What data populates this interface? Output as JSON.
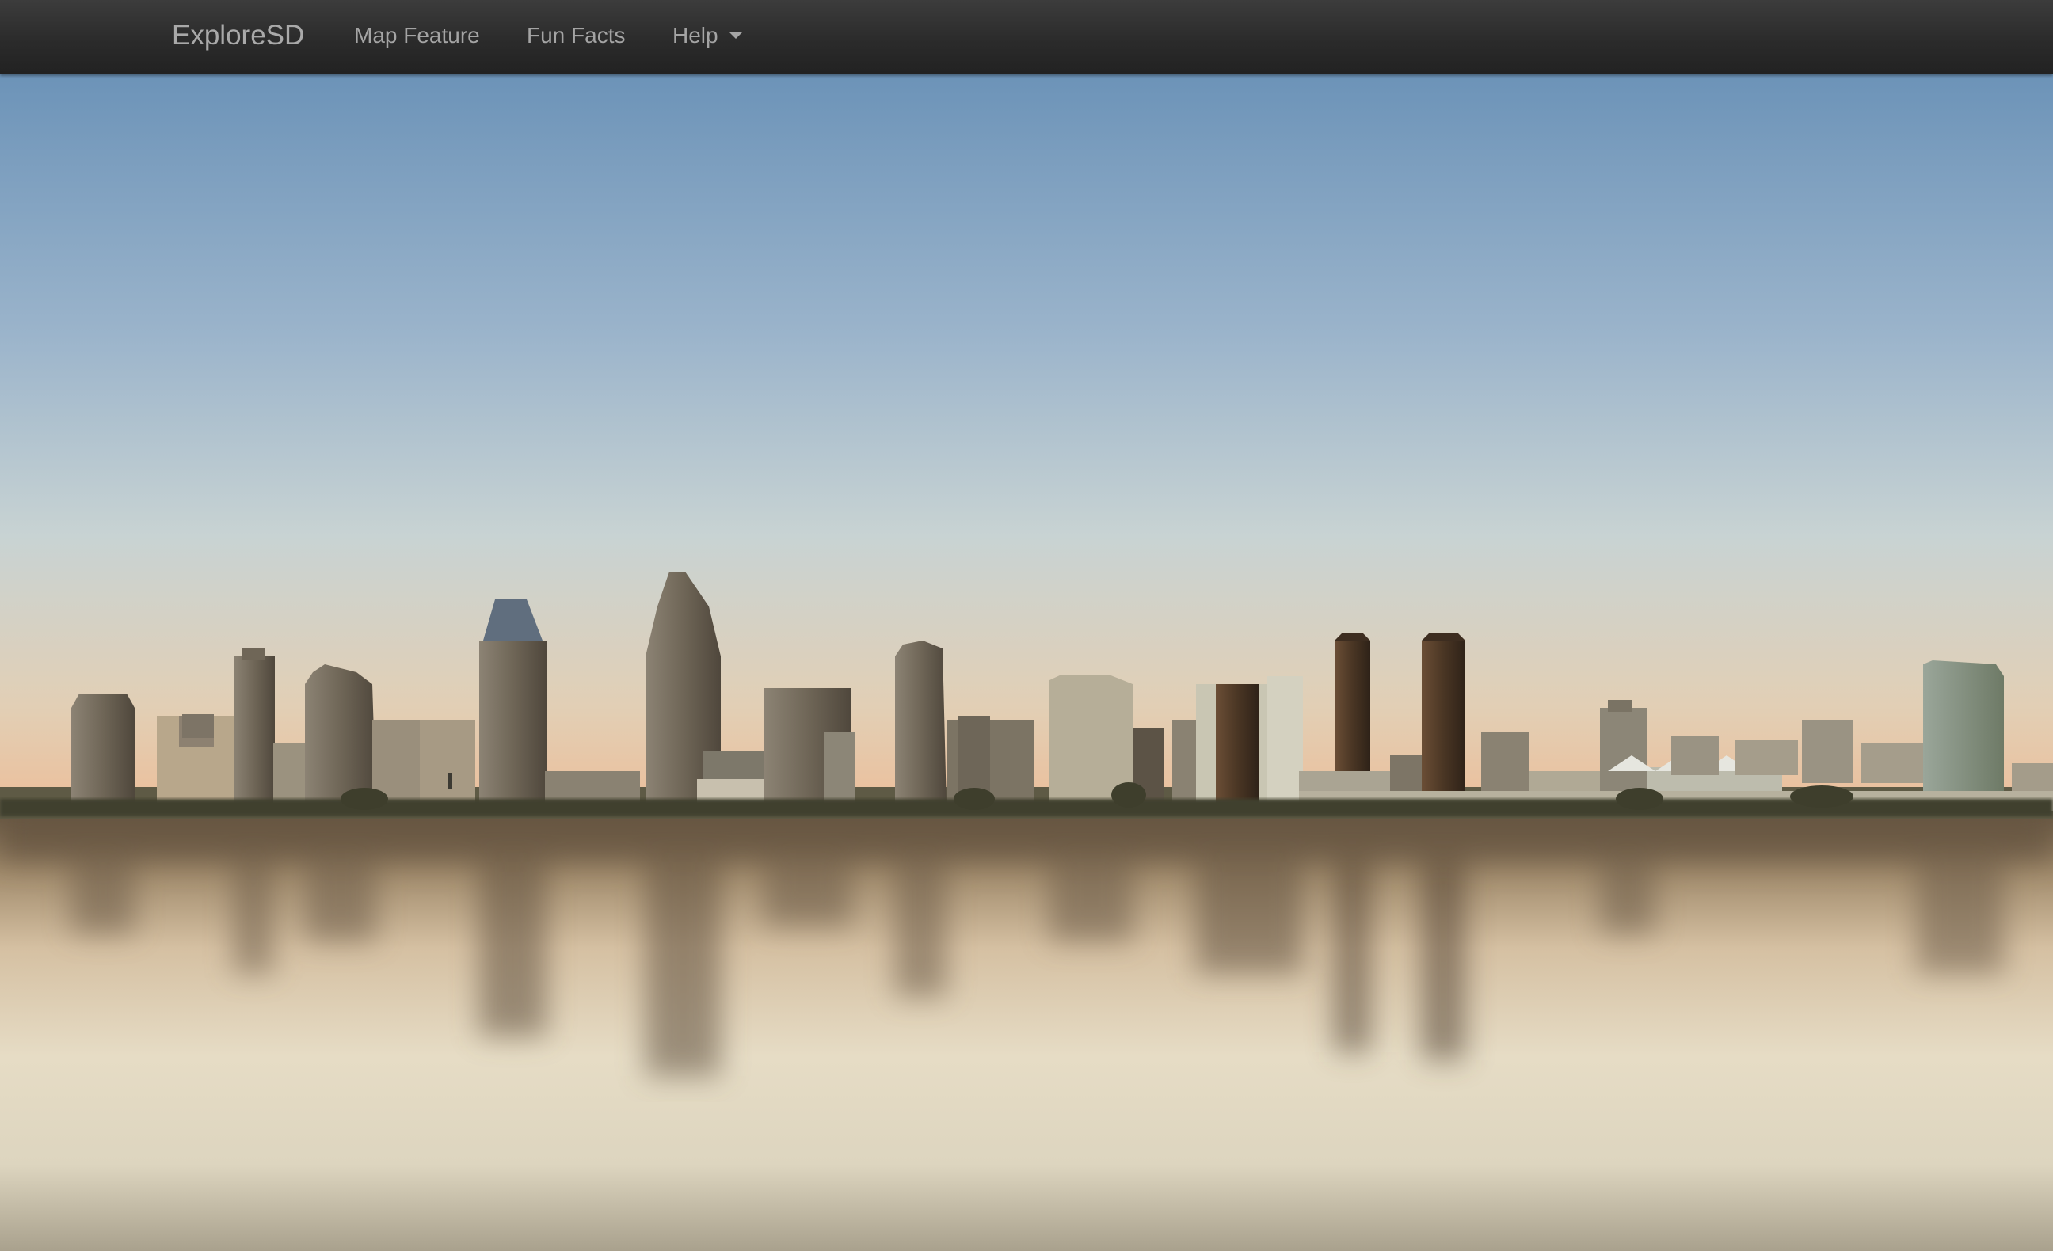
{
  "navbar": {
    "brand": "ExploreSD",
    "items": [
      {
        "label": "Map Feature"
      },
      {
        "label": "Fun Facts"
      },
      {
        "label": "Help",
        "dropdown": true
      }
    ]
  },
  "hero": {
    "subject": "San Diego downtown skyline reflected over the bay at sunset",
    "colors": {
      "sky_top": "#6c93b8",
      "sky_mid": "#c3d0d3",
      "horizon": "#e9c5a3",
      "water_dark": "#6b5a44",
      "water_light": "#e4dcc8"
    }
  }
}
